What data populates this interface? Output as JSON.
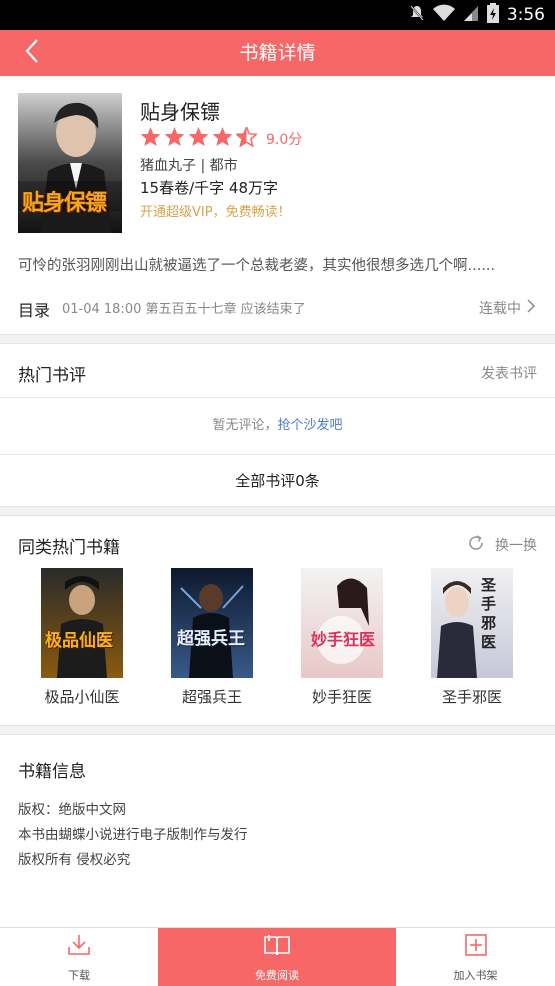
{
  "status_bar": {
    "time": "3:56"
  },
  "header": {
    "title": "书籍详情"
  },
  "book": {
    "title": "贴身保镖",
    "cover_text": "贴身保镖",
    "rating_stars": 4.5,
    "score": "9.0分",
    "author_category": "猪血丸子 | 都市",
    "stats": "15春卷/千字  48万字",
    "vip_promo": "开通超级VIP，免费畅读！",
    "summary": "可怜的张羽刚刚出山就被逼选了一个总裁老婆，其实他很想多选几个啊......"
  },
  "toc": {
    "label": "目录",
    "latest": "01-04 18:00 第五百五十七章 应该结束了",
    "status": "连载中"
  },
  "reviews": {
    "title": "热门书评",
    "action": "发表书评",
    "empty_text": "暂无评论，",
    "empty_link": "抢个沙发吧",
    "all_label": "全部书评0条"
  },
  "similar": {
    "title": "同类热门书籍",
    "refresh_label": "换一换",
    "books": [
      {
        "title": "极品小仙医",
        "cover_text": "极品仙医",
        "color_top": "#2a2a2a",
        "color_bottom": "#8a5a10"
      },
      {
        "title": "超强兵王",
        "cover_text": "超强兵王",
        "color_top": "#0d1a2e",
        "color_bottom": "#3a5a8a"
      },
      {
        "title": "妙手狂医",
        "cover_text": "妙手狂医",
        "color_top": "#f3f3f3",
        "color_bottom": "#e8c8c8"
      },
      {
        "title": "圣手邪医",
        "cover_text": "圣手邪医",
        "color_top": "#f0f0f2",
        "color_bottom": "#c6c8d8"
      }
    ]
  },
  "info": {
    "title": "书籍信息",
    "lines": [
      "版权：绝版中文网",
      "本书由蝴蝶小说进行电子版制作与发行",
      "版权所有 侵权必究"
    ]
  },
  "bottom_bar": {
    "download": "下载",
    "read": "免费阅读",
    "add_shelf": "加入书架"
  },
  "colors": {
    "accent": "#f86767",
    "vip": "#d9a24a",
    "link": "#4a7bd0"
  }
}
